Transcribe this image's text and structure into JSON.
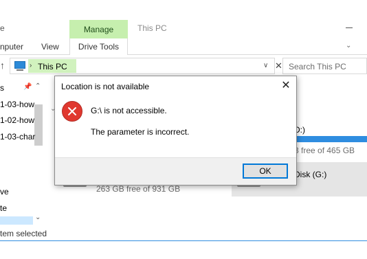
{
  "window": {
    "title": "This PC",
    "title_left_fragment": "e",
    "context_tab_header": "Manage",
    "ribbon_tabs": [
      {
        "label": "nputer"
      },
      {
        "label": "View"
      },
      {
        "label": "Drive Tools"
      }
    ]
  },
  "address_bar": {
    "path": "This PC",
    "search_placeholder": "Search This PC"
  },
  "nav_pane": {
    "items": [
      {
        "label": "s"
      },
      {
        "label": "1-03-how"
      },
      {
        "label": "1-02-how"
      },
      {
        "label": "1-03-char"
      },
      {
        "label": "ve"
      },
      {
        "label": "te"
      }
    ]
  },
  "drives": {
    "right_top_label": "D:)",
    "right_top_free": "3 free of 465 GB",
    "right_top_usage_fraction": 1.0,
    "right_bottom_label": "Disk (G:)",
    "left_bottom_free": "263 GB free of 931 GB"
  },
  "status_bar": {
    "text": "tem selected"
  },
  "dialog": {
    "title": "Location is not available",
    "message_primary": "G:\\ is not accessible.",
    "message_secondary": "The parameter is incorrect.",
    "ok_label": "OK"
  },
  "colors": {
    "context_tab_green": "#c6efae",
    "accent_blue": "#0078d7",
    "error_red": "#e0382f",
    "drive_bar_blue": "#2f8de0"
  },
  "icons": [
    "up-arrow-icon",
    "computer-icon",
    "chevron-right-icon",
    "chevron-down-icon",
    "close-icon",
    "pin-icon",
    "error-icon",
    "hard-drive-icon"
  ]
}
